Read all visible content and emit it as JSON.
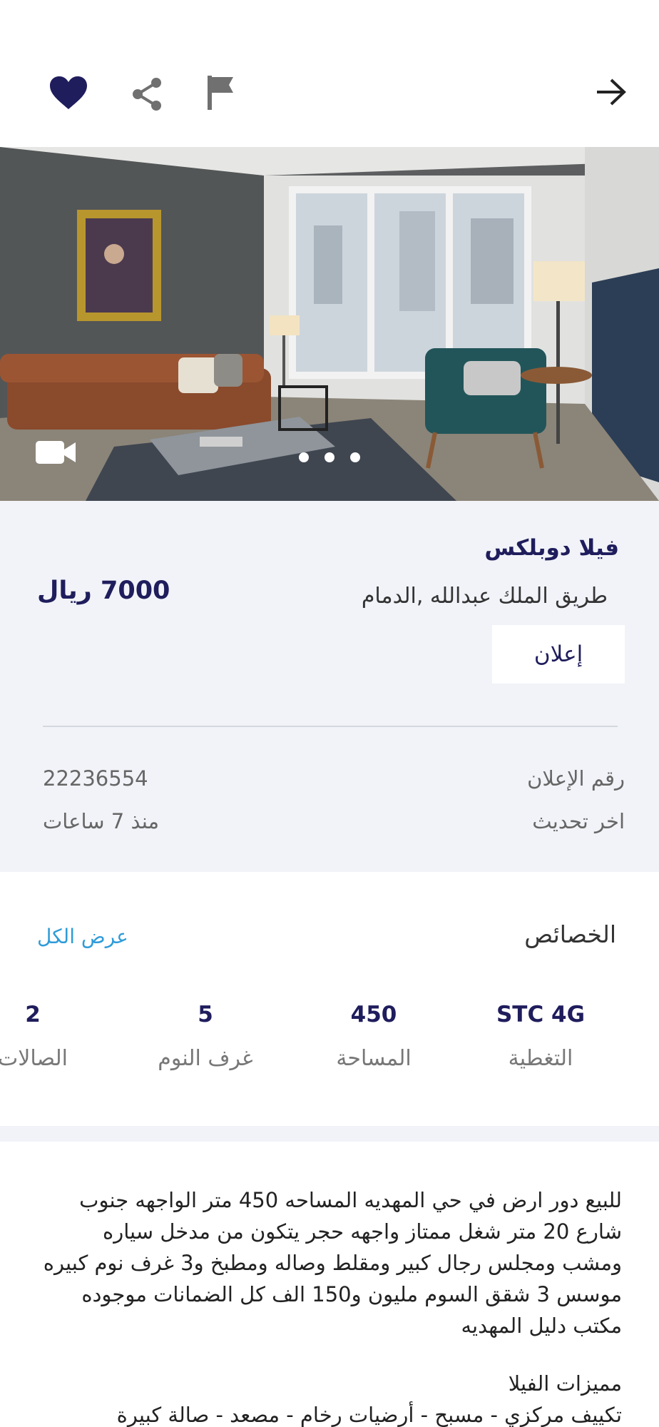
{
  "listing": {
    "title": "فيلا دوبلكس",
    "location": "طريق الملك عبدالله ,الدمام",
    "price": "7000 ريال",
    "ad_button": "إعلان",
    "meta": [
      {
        "label": "رقم الإعلان",
        "value": "22236554"
      },
      {
        "label": "اخر تحديث",
        "value": "منذ 7 ساعات"
      }
    ]
  },
  "features": {
    "title": "الخصائص",
    "view_all": "عرض الكل",
    "items": [
      {
        "value": "STC 4G",
        "label": "التغطية"
      },
      {
        "value": "450",
        "label": "المساحة"
      },
      {
        "value": "5",
        "label": "غرف النوم"
      },
      {
        "value": "2",
        "label": "الصالات"
      }
    ]
  },
  "description": {
    "text": "للبيع دور ارض في حي المهديه المساحه 450 متر الواجهه جنوب شارع 20 متر شغل ممتاز واجهه حجر يتكون من مدخل سياره ومشب ومجلس رجال كبير ومقلط وصاله ومطبخ و3 غرف نوم كبيره موسس 3 شقق السوم مليون و150 الف كل الضمانات موجوده مكتب دليل المهديه",
    "features_heading": "مميزات الفيلا",
    "features_list": "تكييف مركزي - مسبح - أرضيات رخام - مصعد - صالة كبيرة"
  },
  "gallery": {
    "dot_count": 3,
    "active_dot": 0
  },
  "icons": {
    "favorite": "heart-icon",
    "share": "share-icon",
    "report": "flag-icon",
    "back": "arrow-right-icon",
    "video": "video-camera-icon"
  },
  "colors": {
    "accent": "#1f1d5c",
    "link": "#2f9bd8",
    "panel": "#f1f3f8"
  }
}
